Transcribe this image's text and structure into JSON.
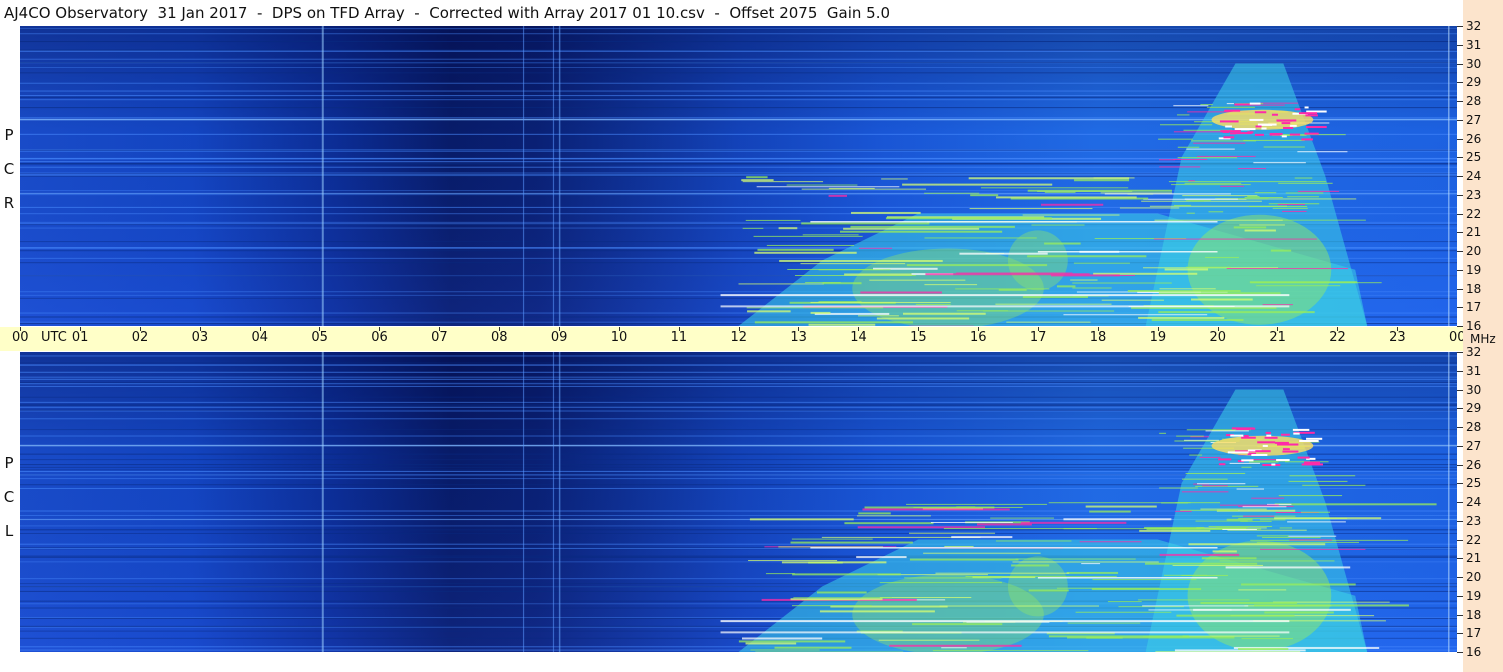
{
  "header": {
    "title": "AJ4CO Observatory  31 Jan 2017  -  DPS on TFD Array  -  Corrected with Array 2017 01 10.csv  -  Offset 2075  Gain 5.0"
  },
  "panels": {
    "top": {
      "polarization_letters": [
        "P",
        "C",
        "R"
      ]
    },
    "bottom": {
      "polarization_letters": [
        "P",
        "C",
        "L"
      ]
    }
  },
  "time_axis": {
    "ticks": [
      "00",
      "01",
      "02",
      "03",
      "04",
      "05",
      "06",
      "07",
      "08",
      "09",
      "10",
      "11",
      "12",
      "13",
      "14",
      "15",
      "16",
      "17",
      "18",
      "19",
      "20",
      "21",
      "22",
      "23",
      "00"
    ],
    "label": "UTC"
  },
  "freq_axis": {
    "ticks": [
      "32",
      "31",
      "30",
      "29",
      "28",
      "27",
      "26",
      "25",
      "24",
      "23",
      "22",
      "21",
      "20",
      "19",
      "18",
      "17",
      "16"
    ],
    "unit": "MHz"
  },
  "colors": {
    "background_low": "#0a2a8c",
    "background_mid": "#1e64e6",
    "emission_cyan": "#3cd2e6",
    "emission_green": "#9aee5a",
    "emission_hot": "#ff2aa8",
    "utc_band": "#ffffc8",
    "freq_column": "#fce4cc"
  },
  "chart_data": {
    "type": "heatmap",
    "title": "AJ4CO Observatory  31 Jan 2017  -  DPS on TFD Array  -  Corrected with Array 2017 01 10.csv  -  Offset 2075  Gain 5.0",
    "x_axis": {
      "label": "UTC",
      "range_hours": [
        0,
        24
      ]
    },
    "y_axis": {
      "label": "MHz",
      "range": [
        16,
        32
      ]
    },
    "panels": [
      "RCP",
      "LCP"
    ],
    "emission_features": [
      {
        "name": "",
        "t_start": 12,
        "t_end": 22.5,
        "f_low": 16,
        "f_high": 22,
        "intensity": "moderate"
      },
      {
        "name": "",
        "t_start": 18.8,
        "t_end": 22.5,
        "f_low": 16,
        "f_high": 30,
        "intensity": "strong"
      },
      {
        "name": "",
        "t_start": 20,
        "t_end": 21.5,
        "f_low": 26,
        "f_high": 28,
        "intensity": "saturated"
      }
    ]
  }
}
